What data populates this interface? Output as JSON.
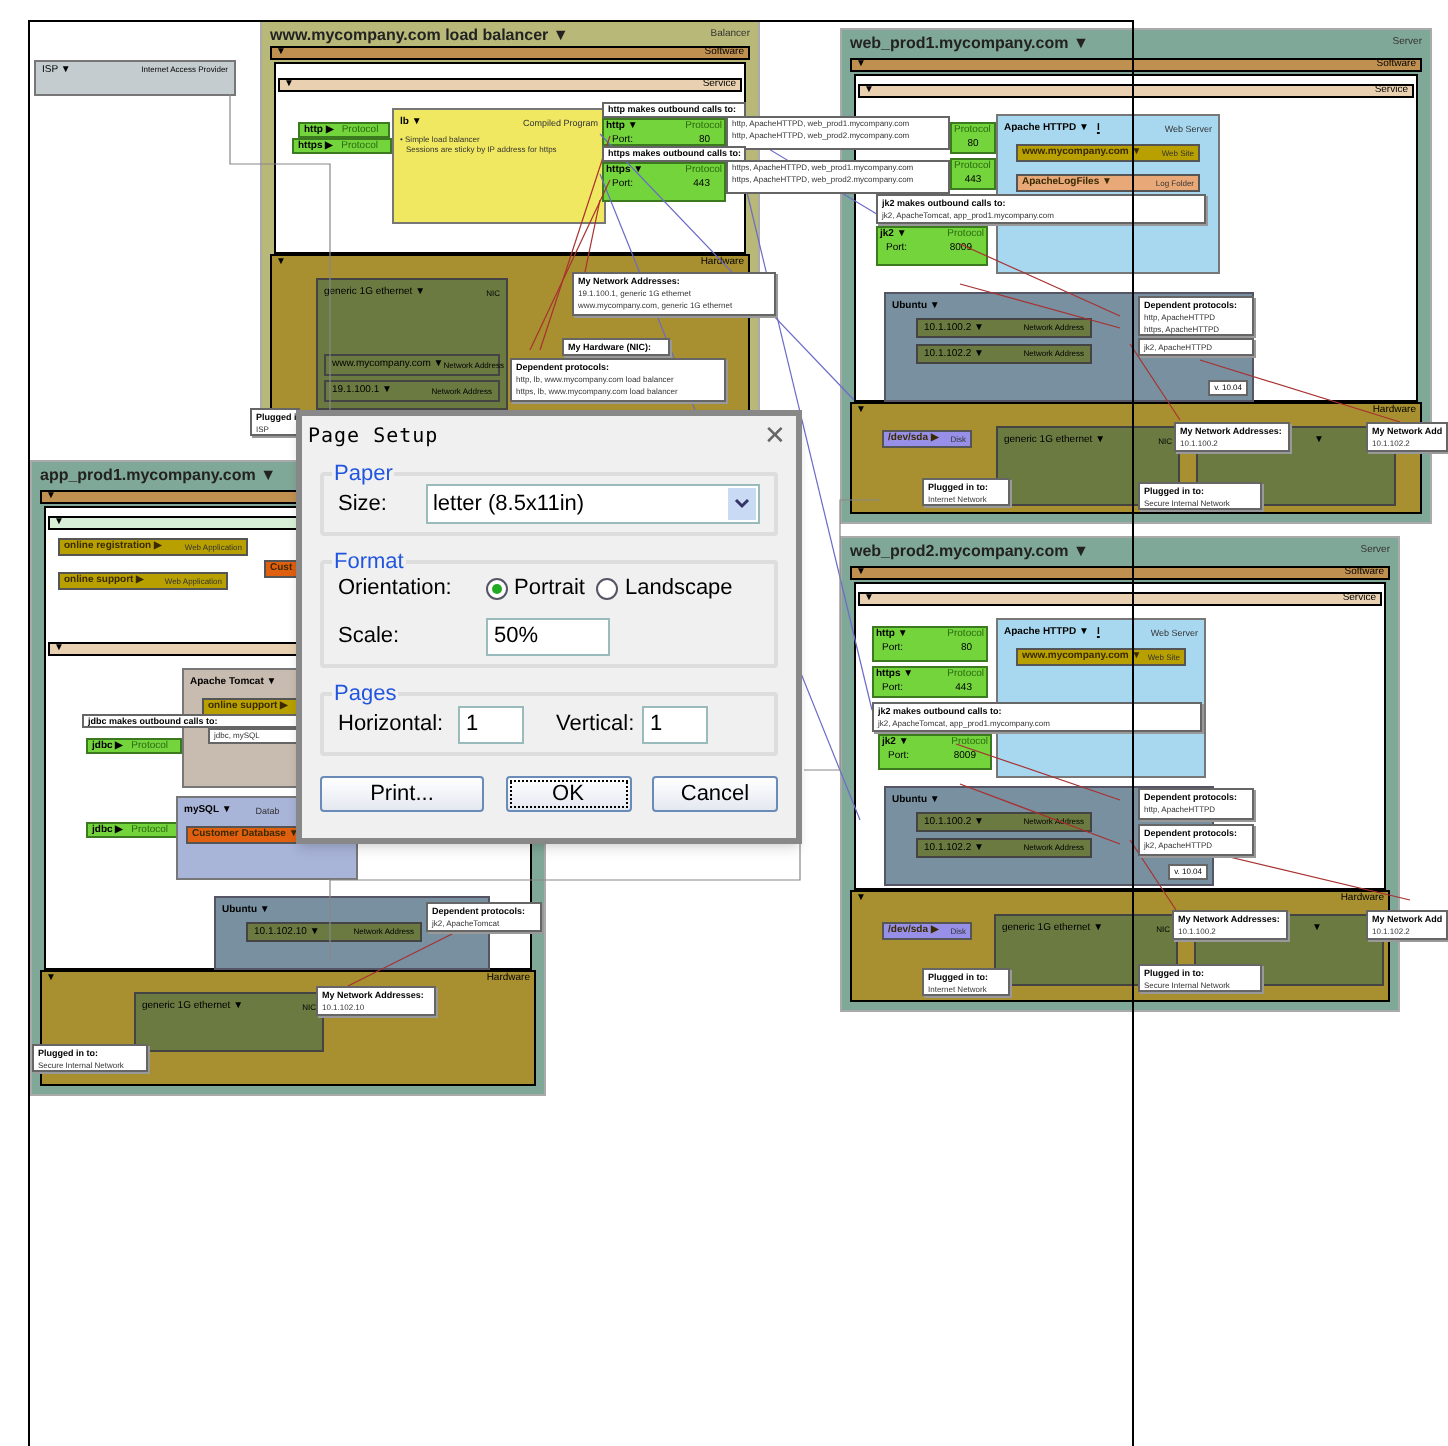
{
  "isp": {
    "name": "ISP",
    "menu": "▼",
    "role": "Internet Access Provider"
  },
  "servers": [
    {
      "kind": "balancer",
      "name": "www.mycompany.com load balancer",
      "menu": "▼",
      "role": "Balancer",
      "software": {
        "toggle": "▼",
        "label": "Software"
      },
      "service": {
        "toggle": "▼",
        "label": "Service"
      },
      "hardware": {
        "toggle": "▼",
        "label": "Hardware"
      },
      "items": [
        {
          "kind": "stub",
          "name": "http",
          "arrow": "▶",
          "type": "Protocol"
        },
        {
          "kind": "stub",
          "name": "https",
          "arrow": "▶",
          "type": "Protocol"
        },
        {
          "kind": "program",
          "name": "lb",
          "menu": "▼",
          "type": "Compiled Program",
          "lines": [
            "• Simple load balancer",
            "Sessions are sticky by IP address for https"
          ]
        },
        {
          "kind": "callout",
          "title": "http makes outbound calls to:",
          "lines": [
            "http, ApacheHTTPD, web_prod1.mycompany.com",
            "http, ApacheHTTPD, web_prod2.mycompany.com"
          ]
        },
        {
          "kind": "protocol",
          "name": "http",
          "menu": "▼",
          "type": "Protocol",
          "port_label": "Port:",
          "port": "80"
        },
        {
          "kind": "callout",
          "title": "https makes outbound calls to:",
          "lines": [
            "https, ApacheHTTPD, web_prod1.mycompany.com",
            "https, ApacheHTTPD, web_prod2.mycompany.com"
          ]
        },
        {
          "kind": "protocol",
          "name": "https",
          "menu": "▼",
          "type": "Protocol",
          "port_label": "Port:",
          "port": "443"
        },
        {
          "kind": "nic",
          "name": "generic 1G ethernet",
          "menu": "▼",
          "type": "NIC",
          "addresses": [
            {
              "value": "www.mycompany.com",
              "menu": "▼",
              "label": "Network Address"
            },
            {
              "value": "19.1.100.1",
              "menu": "▼",
              "label": "Network Address"
            }
          ]
        },
        {
          "kind": "callout",
          "title": "My Network Addresses:",
          "lines": [
            "19.1.100.1, generic 1G ethernet",
            "www.mycompany.com, generic 1G ethernet"
          ]
        },
        {
          "kind": "callout",
          "title": "My Hardware (NIC):"
        },
        {
          "kind": "callout",
          "title": "Dependent protocols:",
          "lines": [
            "http, lb, www.mycompany.com load balancer",
            "https, lb, www.mycompany.com load balancer"
          ]
        },
        {
          "kind": "callout",
          "title": "Plugged i",
          "lines": [
            "ISP"
          ]
        }
      ]
    },
    {
      "kind": "server",
      "name": "web_prod1.mycompany.com",
      "menu": "▼",
      "role": "Server",
      "software": {
        "toggle": "▼",
        "label": "Software"
      },
      "service": {
        "toggle": "▼",
        "label": "Service"
      },
      "hardware": {
        "toggle": "▼",
        "label": "Hardware"
      },
      "items": [
        {
          "kind": "protocol",
          "type": "Protocol",
          "port": "80"
        },
        {
          "kind": "protocol",
          "type": "Protocol",
          "port": "443"
        },
        {
          "kind": "web-server",
          "name": "Apache HTTPD",
          "menu": "▼",
          "marker": "I",
          "type": "Web Server",
          "children": [
            {
              "name": "www.mycompany.com",
              "menu": "▼",
              "type": "Web Site",
              "color": "#b8a000"
            },
            {
              "name": "ApacheLogFiles",
              "menu": "▼",
              "type": "Log Folder",
              "color": "#e8a878"
            }
          ]
        },
        {
          "kind": "callout",
          "title": "jk2 makes outbound calls to:",
          "lines": [
            "jk2, ApacheTomcat, app_prod1.mycompany.com"
          ]
        },
        {
          "kind": "protocol",
          "name": "jk2",
          "menu": "▼",
          "type": "Protocol",
          "port_label": "Port:",
          "port": "8009"
        },
        {
          "kind": "os",
          "name": "Ubuntu",
          "menu": "▼",
          "version": "v. 10.04",
          "addresses": [
            {
              "value": "10.1.100.2",
              "menu": "▼",
              "label": "Network Address"
            },
            {
              "value": "10.1.102.2",
              "menu": "▼",
              "label": "Network Address"
            }
          ]
        },
        {
          "kind": "callout",
          "title": "Dependent protocols:",
          "lines": [
            "http, ApacheHTTPD",
            "https, ApacheHTTPD"
          ]
        },
        {
          "kind": "callout",
          "lines": [
            "jk2, ApacheHTTPD"
          ]
        },
        {
          "kind": "tag",
          "name": "/dev/sda",
          "menu": "▶",
          "type": "Disk",
          "color": "#9890e8"
        },
        {
          "kind": "nic",
          "name": "generic 1G ethernet",
          "menu": "▼",
          "type": "NIC"
        },
        {
          "kind": "callout",
          "title": "My Network Addresses:",
          "lines": [
            "10.1.100.2"
          ]
        },
        {
          "kind": "nic",
          "menu": "▼"
        },
        {
          "kind": "callout",
          "title": "My Network Add",
          "lines": [
            "10.1.102.2"
          ]
        },
        {
          "kind": "callout",
          "title": "Plugged in to:",
          "lines": [
            "Internet Network"
          ]
        },
        {
          "kind": "callout",
          "title": "Plugged in to:",
          "lines": [
            "Secure Internal Network"
          ]
        }
      ]
    },
    {
      "kind": "server",
      "name": "app_prod1.mycompany.com",
      "menu": "▼",
      "software": {
        "toggle": "▼"
      },
      "subsection": {
        "toggle": "▼"
      },
      "service": {
        "toggle": "▼"
      },
      "hardware": {
        "toggle": "▼",
        "label": "Hardware"
      },
      "items": [
        {
          "kind": "tag",
          "name": "online registration",
          "menu": "▶",
          "type": "Web Application",
          "color": "#b8a000"
        },
        {
          "kind": "tag",
          "name": "online support",
          "menu": "▶",
          "type": "Web Application",
          "color": "#b8a000"
        },
        {
          "kind": "tag",
          "name": "Cust",
          "color": "#e06010"
        },
        {
          "kind": "app-server",
          "name": "Apache Tomcat",
          "menu": "▼",
          "children": [
            {
              "name": "online support",
              "menu": "▶",
              "color": "#b8a000"
            }
          ]
        },
        {
          "kind": "callout",
          "title": "jdbc makes outbound calls to:",
          "lines": [
            "jdbc, mySQL"
          ]
        },
        {
          "kind": "stub",
          "name": "jdbc",
          "arrow": "▶",
          "type": "Protocol"
        },
        {
          "kind": "stub",
          "name": "jdbc",
          "arrow": "▶",
          "type": "Protocol"
        },
        {
          "kind": "database",
          "name": "mySQL",
          "menu": "▼",
          "type": "Datab",
          "children": [
            {
              "name": "Customer Database",
              "menu": "▼",
              "color": "#e06010"
            }
          ]
        },
        {
          "kind": "os",
          "name": "Ubuntu",
          "menu": "▼",
          "addresses": [
            {
              "value": "10.1.102.10",
              "menu": "▼",
              "label": "Network Address"
            }
          ]
        },
        {
          "kind": "callout",
          "title": "Dependent protocols:",
          "lines": [
            "jk2, ApacheTomcat"
          ]
        },
        {
          "kind": "nic",
          "name": "generic 1G ethernet",
          "menu": "▼",
          "type": "NIC"
        },
        {
          "kind": "callout",
          "title": "My Network Addresses:",
          "lines": [
            "10.1.102.10"
          ]
        },
        {
          "kind": "callout",
          "title": "Plugged in to:",
          "lines": [
            "Secure Internal Network"
          ]
        }
      ]
    },
    {
      "kind": "server",
      "name": "web_prod2.mycompany.com",
      "menu": "▼",
      "role": "Server",
      "software": {
        "toggle": "▼",
        "label": "Software"
      },
      "service": {
        "toggle": "▼",
        "label": "Service"
      },
      "hardware": {
        "toggle": "▼",
        "label": "Hardware"
      },
      "items": [
        {
          "kind": "protocol",
          "name": "http",
          "menu": "▼",
          "type": "Protocol",
          "port_label": "Port:",
          "port": "80"
        },
        {
          "kind": "protocol",
          "name": "https",
          "menu": "▼",
          "type": "Protocol",
          "port_label": "Port:",
          "port": "443"
        },
        {
          "kind": "web-server",
          "name": "Apache HTTPD",
          "menu": "▼",
          "marker": "I",
          "type": "Web Server",
          "children": [
            {
              "name": "www.mycompany.com",
              "menu": "▼",
              "type": "Web Site",
              "color": "#b8a000"
            }
          ]
        },
        {
          "kind": "callout",
          "title": "jk2 makes outbound calls to:",
          "lines": [
            "jk2, ApacheTomcat, app_prod1.mycompany.com"
          ]
        },
        {
          "kind": "protocol",
          "name": "jk2",
          "menu": "▼",
          "type": "Protocol",
          "port_label": "Port:",
          "port": "8009"
        },
        {
          "kind": "os",
          "name": "Ubuntu",
          "menu": "▼",
          "version": "v. 10.04",
          "addresses": [
            {
              "value": "10.1.100.2",
              "menu": "▼",
              "label": "Network Address"
            },
            {
              "value": "10.1.102.2",
              "menu": "▼",
              "label": "Network Address"
            }
          ]
        },
        {
          "kind": "callout",
          "title": "Dependent protocols:",
          "lines": [
            "http, ApacheHTTPD"
          ]
        },
        {
          "kind": "callout",
          "title": "Dependent protocols:",
          "lines": [
            "jk2, ApacheHTTPD"
          ]
        },
        {
          "kind": "tag",
          "name": "/dev/sda",
          "menu": "▶",
          "type": "Disk",
          "color": "#9890e8"
        },
        {
          "kind": "nic",
          "name": "generic 1G ethernet",
          "menu": "▼",
          "type": "NIC"
        },
        {
          "kind": "callout",
          "title": "My Network Addresses:",
          "lines": [
            "10.1.100.2"
          ]
        },
        {
          "kind": "nic",
          "menu": "▼"
        },
        {
          "kind": "callout",
          "title": "My Network Add",
          "lines": [
            "10.1.102.2"
          ]
        },
        {
          "kind": "callout",
          "title": "Plugged in to:",
          "lines": [
            "Internet Network"
          ]
        },
        {
          "kind": "callout",
          "title": "Plugged in to:",
          "lines": [
            "Secure Internal Network"
          ]
        }
      ]
    }
  ],
  "dialog": {
    "title": "Page Setup",
    "close": "✕",
    "paper": {
      "legend": "Paper",
      "size_label": "Size:",
      "size": "letter (8.5x11in)"
    },
    "format": {
      "legend": "Format",
      "orientation_label": "Orientation:",
      "orientations": [
        {
          "label": "Portrait",
          "selected": true
        },
        {
          "label": "Landscape",
          "selected": false
        }
      ],
      "scale_label": "Scale:",
      "scale": "50%"
    },
    "pages": {
      "legend": "Pages",
      "horizontal_label": "Horizontal:",
      "horizontal": "1",
      "vertical_label": "Vertical:",
      "vertical": "1"
    },
    "buttons": [
      {
        "label": "Print...",
        "focused": false
      },
      {
        "label": "OK",
        "focused": true
      },
      {
        "label": "Cancel",
        "focused": false
      }
    ]
  }
}
